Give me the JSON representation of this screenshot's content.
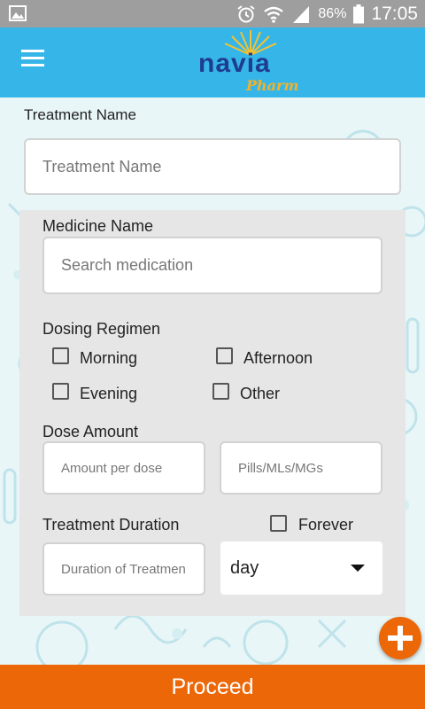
{
  "status_bar": {
    "battery_percent": "86%",
    "time": "17:05",
    "icons": [
      "gallery-icon",
      "alarm-icon",
      "wifi-icon",
      "signal-icon",
      "battery-icon"
    ]
  },
  "app_bar": {
    "menu_icon": "hamburger-icon",
    "logo": {
      "main": "navia",
      "sub": "Pharm"
    }
  },
  "form": {
    "treatment_name": {
      "label": "Treatment Name",
      "placeholder": "Treatment Name"
    },
    "medicine_name": {
      "label": "Medicine Name",
      "placeholder": "Search medication"
    },
    "dosing_regimen": {
      "label": "Dosing Regimen",
      "options": [
        {
          "label": "Morning",
          "checked": false
        },
        {
          "label": "Afternoon",
          "checked": false
        },
        {
          "label": "Evening",
          "checked": false
        },
        {
          "label": "Other",
          "checked": false
        }
      ]
    },
    "dose_amount": {
      "label": "Dose Amount",
      "amount_placeholder": "Amount per dose",
      "unit_placeholder": "Pills/MLs/MGs"
    },
    "treatment_duration": {
      "label": "Treatment Duration",
      "forever_label": "Forever",
      "forever_checked": false,
      "duration_placeholder": "Duration of Treatmen",
      "unit_selected": "day"
    }
  },
  "fab_icon": "plus-icon",
  "proceed_label": "Proceed",
  "colors": {
    "app_bar": "#36b6e8",
    "accent_orange": "#ec6708",
    "panel": "#e6e6e6",
    "status_bar": "#9e9e9e"
  }
}
